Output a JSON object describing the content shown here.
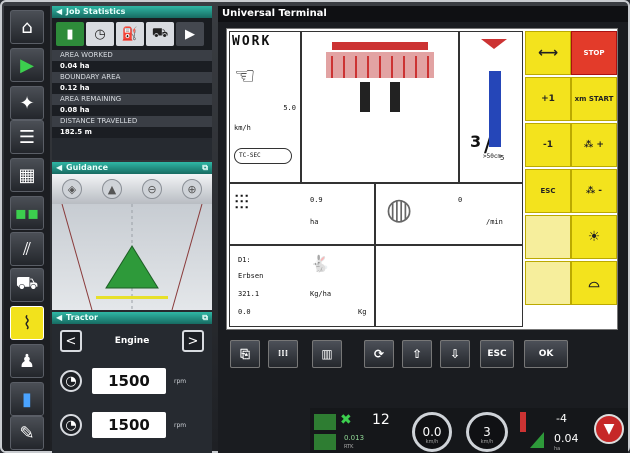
{
  "iconbar": [
    {
      "name": "home-icon",
      "glyph": "⌂"
    },
    {
      "name": "play-icon",
      "glyph": "▶"
    },
    {
      "name": "satellite-icon",
      "glyph": "✦"
    },
    {
      "name": "list-icon",
      "glyph": "☰"
    },
    {
      "name": "calculator-icon",
      "glyph": "▦"
    },
    {
      "name": "lightbar-icon",
      "glyph": "▪▪"
    },
    {
      "name": "implement-icon",
      "glyph": "⫽"
    },
    {
      "name": "tractor-icon",
      "glyph": "⛟"
    },
    {
      "name": "sprayer-icon",
      "glyph": "⌇"
    },
    {
      "name": "person-icon",
      "glyph": "♟"
    },
    {
      "name": "tank-icon",
      "glyph": "▮"
    },
    {
      "name": "wrench-icon",
      "glyph": "✎"
    }
  ],
  "job_statistics": {
    "title": "Job Statistics",
    "tab_next": "▶",
    "rows": [
      {
        "label": "AREA WORKED",
        "value": "0.04 ha"
      },
      {
        "label": "BOUNDARY AREA",
        "value": "0.12 ha"
      },
      {
        "label": "AREA REMAINING",
        "value": "0.08 ha"
      },
      {
        "label": "DISTANCE TRAVELLED",
        "value": "182.5 m"
      }
    ]
  },
  "guidance": {
    "title": "Guidance"
  },
  "tractor": {
    "title": "Tractor",
    "selector": "Engine",
    "rows": [
      {
        "value": "1500",
        "unit": "rpm"
      },
      {
        "value": "1500",
        "unit": "rpm"
      }
    ]
  },
  "terminal": {
    "title": "Universal Terminal",
    "work_label": "WORK",
    "speed_unit": "km/h",
    "speed_value": "5.0",
    "tc_label": "TC-SEC",
    "fraction_num": "3",
    "fraction_den": "5",
    "depth_label": ">50cm",
    "area_value": "0.9",
    "area_unit": "ha",
    "fan_value": "0",
    "fan_unit": "/min",
    "product_d": "D1:",
    "product_name": "Erbsen",
    "rate_value": "321.1",
    "rate_unit": "Kg/ha",
    "amount_value": "0.0",
    "amount_unit": "Kg",
    "softkeys": [
      {
        "label": "⟷",
        "name": "switch-softkey"
      },
      {
        "label": "STOP",
        "name": "stop-softkey"
      },
      {
        "label": "+1",
        "name": "plus-one-softkey"
      },
      {
        "label": "xm START",
        "name": "start-softkey"
      },
      {
        "label": "-1",
        "name": "minus-one-softkey"
      },
      {
        "label": "⁂ +",
        "name": "rate-plus-softkey"
      },
      {
        "label": "ESC",
        "name": "esc-softkey"
      },
      {
        "label": "⁂ -",
        "name": "rate-minus-softkey"
      },
      {
        "label": "",
        "name": "blank-softkey"
      },
      {
        "label": "☀",
        "name": "light-softkey"
      },
      {
        "label": "",
        "name": "blank2-softkey"
      },
      {
        "label": "⌓",
        "name": "marker-softkey"
      }
    ],
    "bottom_buttons": [
      {
        "label": "⎘",
        "name": "copy-button"
      },
      {
        "label": "⁞⁞⁞",
        "name": "numbers-button"
      },
      {
        "label": "▥",
        "name": "delete-button"
      },
      {
        "label": "⟳",
        "name": "refresh-button"
      },
      {
        "label": "⇧",
        "name": "up-button"
      },
      {
        "label": "⇩",
        "name": "down-button"
      },
      {
        "label": "ESC",
        "name": "esc-button"
      },
      {
        "label": "OK",
        "name": "ok-button"
      }
    ]
  },
  "status": {
    "sat_count": "12",
    "precision": "0.013",
    "rtk": "RTK",
    "speed": "0.0",
    "speed_unit": "km/h",
    "gear": "3",
    "gear_unit": "km/h",
    "offset": "-4",
    "rate": "0.04",
    "rate_unit": "ha"
  }
}
